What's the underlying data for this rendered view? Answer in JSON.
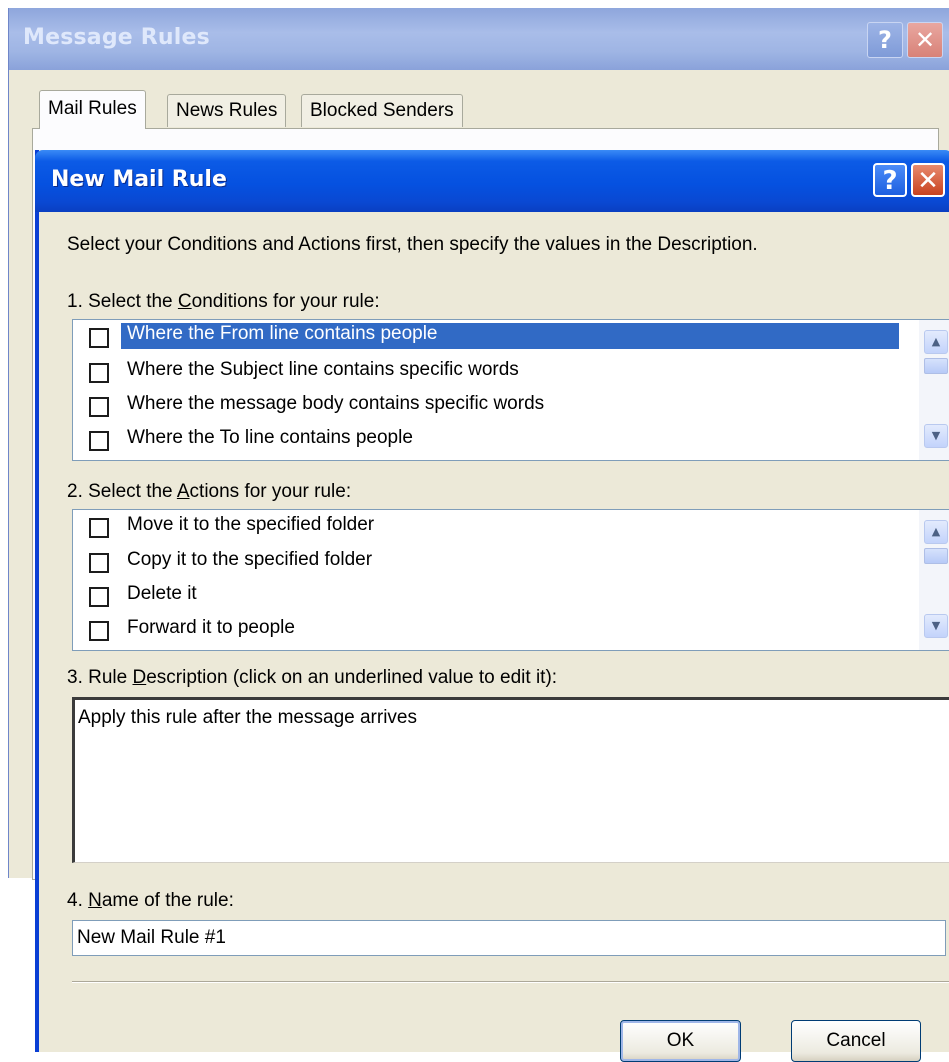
{
  "background_dialog": {
    "title": "Message Rules",
    "help_glyph": "?",
    "close_glyph": "✕",
    "tabs": [
      "Mail Rules",
      "News Rules",
      "Blocked Senders"
    ]
  },
  "dialog": {
    "title": "New Mail Rule",
    "help_glyph": "?",
    "close_glyph": "✕",
    "instruction": "Select your Conditions and Actions first, then specify the values in the Description.",
    "conditions": {
      "label_pre": "1. Select the ",
      "label_accel": "C",
      "label_post": "onditions for your rule:",
      "items": [
        "Where the From line contains people",
        "Where the Subject line contains specific words",
        "Where the message body contains specific words",
        "Where the To line contains people"
      ]
    },
    "actions": {
      "label_pre": "2. Select the ",
      "label_accel": "A",
      "label_post": "ctions for your rule:",
      "items": [
        "Move it to the specified folder",
        "Copy it to the specified folder",
        "Delete it",
        "Forward it to people"
      ]
    },
    "description": {
      "label_pre": "3. Rule ",
      "label_accel": "D",
      "label_post": "escription (click on an underlined value to edit it):",
      "text": "Apply this rule after the message arrives"
    },
    "name": {
      "label_pre": "4. ",
      "label_accel": "N",
      "label_post": "ame of the rule:",
      "value": "New Mail Rule #1"
    },
    "buttons": {
      "ok": "OK",
      "cancel": "Cancel"
    },
    "scroll_up_glyph": "▲",
    "scroll_down_glyph": "▼"
  },
  "colors": {
    "selection": "#316ac5",
    "titlebar_active": "#0551e0",
    "dialog_face": "#ece9d8"
  }
}
